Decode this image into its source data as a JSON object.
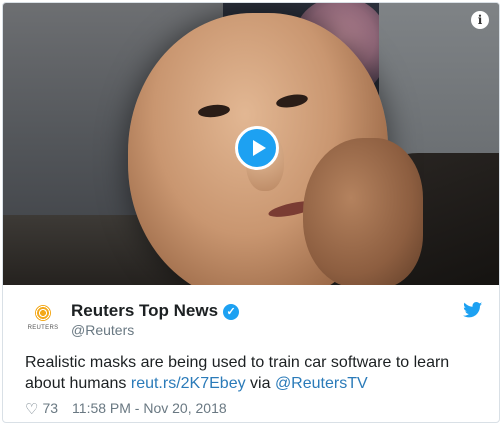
{
  "media": {
    "play_icon": "play-icon",
    "info_icon": "info-icon",
    "info_glyph": "i"
  },
  "author": {
    "name": "Reuters Top News",
    "handle": "@Reuters",
    "avatar_brand": "REUTERS",
    "verified_glyph": "✓",
    "bird_glyph": "🐦"
  },
  "tweet": {
    "text_before": "Realistic masks are being used to train car software to learn about humans ",
    "link": "reut.rs/2K7Ebey",
    "text_via": " via ",
    "mention": "@ReutersTV"
  },
  "meta": {
    "heart_glyph": "♡",
    "likes": "73",
    "timestamp": "11:58 PM - Nov 20, 2018"
  },
  "colors": {
    "accent": "#1da1f2",
    "link": "#2b7bb9",
    "text": "#1c2022",
    "secondary": "#697882"
  }
}
